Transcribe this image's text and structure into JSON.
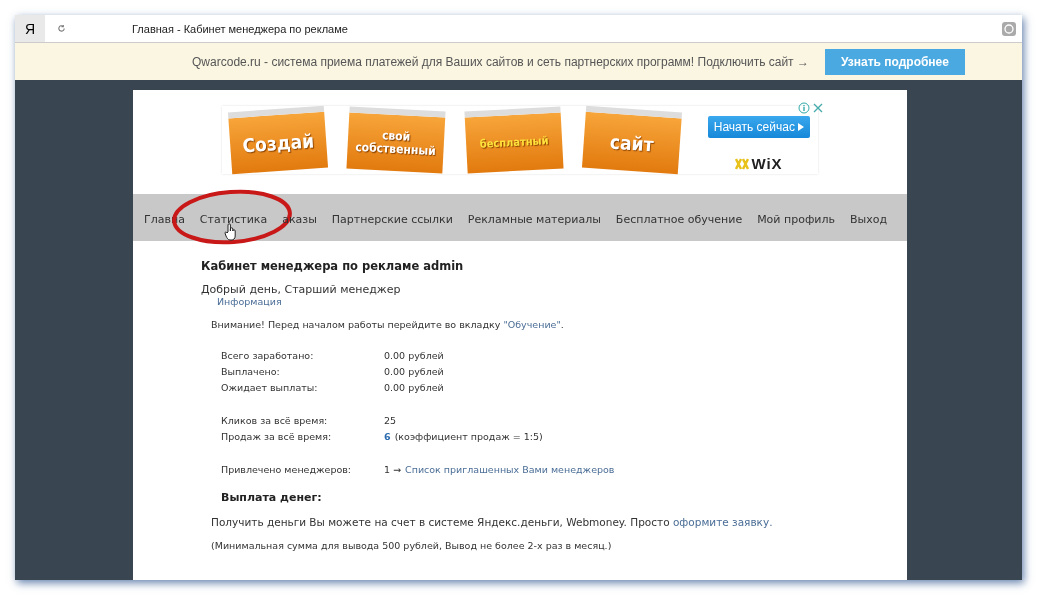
{
  "browser": {
    "logo": "Я",
    "title": "Главная - Кабинет менеджера по рекламе"
  },
  "notice": {
    "text": "Qwarcode.ru - система приема платежей для Ваших сайтов и сеть партнерских программ! Подключить сайт →",
    "button": "Узнать подробнее"
  },
  "ad": {
    "cards": [
      {
        "label": "Создай",
        "kind": "big"
      },
      {
        "label": "свой собственный",
        "kind": "stacked"
      },
      {
        "label": "бесплатный",
        "kind": "yellow"
      },
      {
        "label": "сайт",
        "kind": "big"
      }
    ],
    "button": "Начать сейчас",
    "brand": "WiX"
  },
  "nav": [
    {
      "label": "Главна",
      "circled": false
    },
    {
      "label": "Статистика",
      "circled": true
    },
    {
      "label": "аказы",
      "circled": false
    },
    {
      "label": "Партнерские ссылки",
      "circled": false
    },
    {
      "label": "Рекламные материалы",
      "circled": false
    },
    {
      "label": "Бесплатное обучение",
      "circled": false
    },
    {
      "label": "Мой профиль",
      "circled": false
    },
    {
      "label": "Выход",
      "circled": false
    }
  ],
  "content": {
    "heading": "Кабинет менеджера по рекламе admin",
    "greeting": "Добрый день, Старший менеджер",
    "info_link": "Информация",
    "warning": {
      "text": "Внимание! Перед началом работы перейдите во вкладку",
      "link": "\"Обучение\"",
      "end": "."
    },
    "stat_groups": [
      [
        {
          "label": "Всего заработано:",
          "value": "0.00 рублей",
          "kind": "plain"
        },
        {
          "label": "Выплачено:",
          "value": "0.00 рублей",
          "kind": "plain"
        },
        {
          "label": "Ожидает выплаты:",
          "value": "0.00 рублей",
          "kind": "plain"
        }
      ],
      [
        {
          "label": "Кликов за всё время:",
          "value": "25",
          "kind": "plain"
        },
        {
          "label": "Продаж за всё время:",
          "value": "6",
          "note": "(коэффициент продаж = 1:5)",
          "kind": "count"
        }
      ],
      [
        {
          "label": "Привлечено менеджеров:",
          "value": "1 →",
          "link": "Список приглашенных Вами менеджеров",
          "kind": "link"
        }
      ]
    ],
    "payout": {
      "heading": "Выплата денег:",
      "text": "Получить деньги Вы можете на счет в системе Яндекс.деньги, Webmoney. Просто",
      "link": "оформите заявку.",
      "note": "(Минимальная сумма для вывода 500 рублей, Вывод не более 2-х раз в месяц.)"
    }
  }
}
